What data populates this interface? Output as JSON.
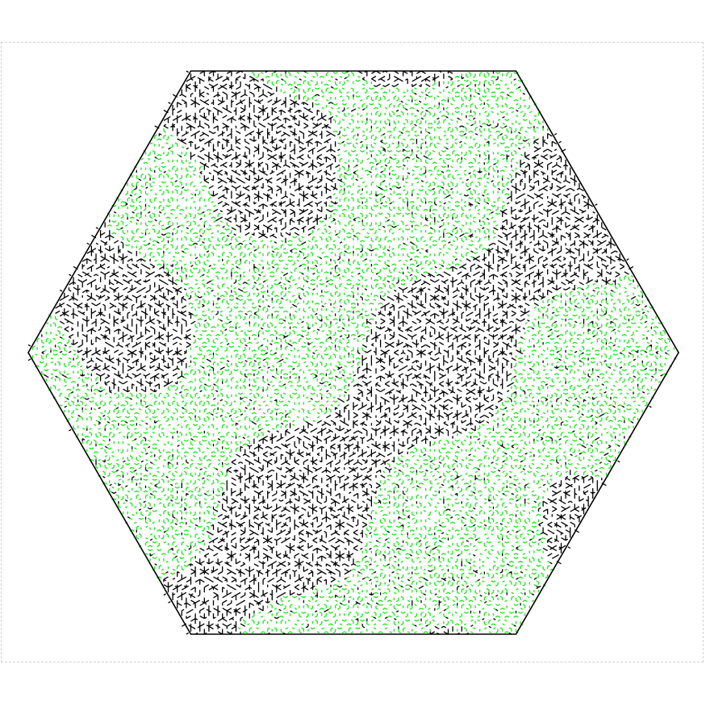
{
  "maze": {
    "shape": "hexagon",
    "cell_type": "triangular",
    "colors": {
      "walls": "#000000",
      "path": "#19e619",
      "background": "#ffffff",
      "frame": "#d0d0d0"
    },
    "frame_style": "dashed"
  }
}
